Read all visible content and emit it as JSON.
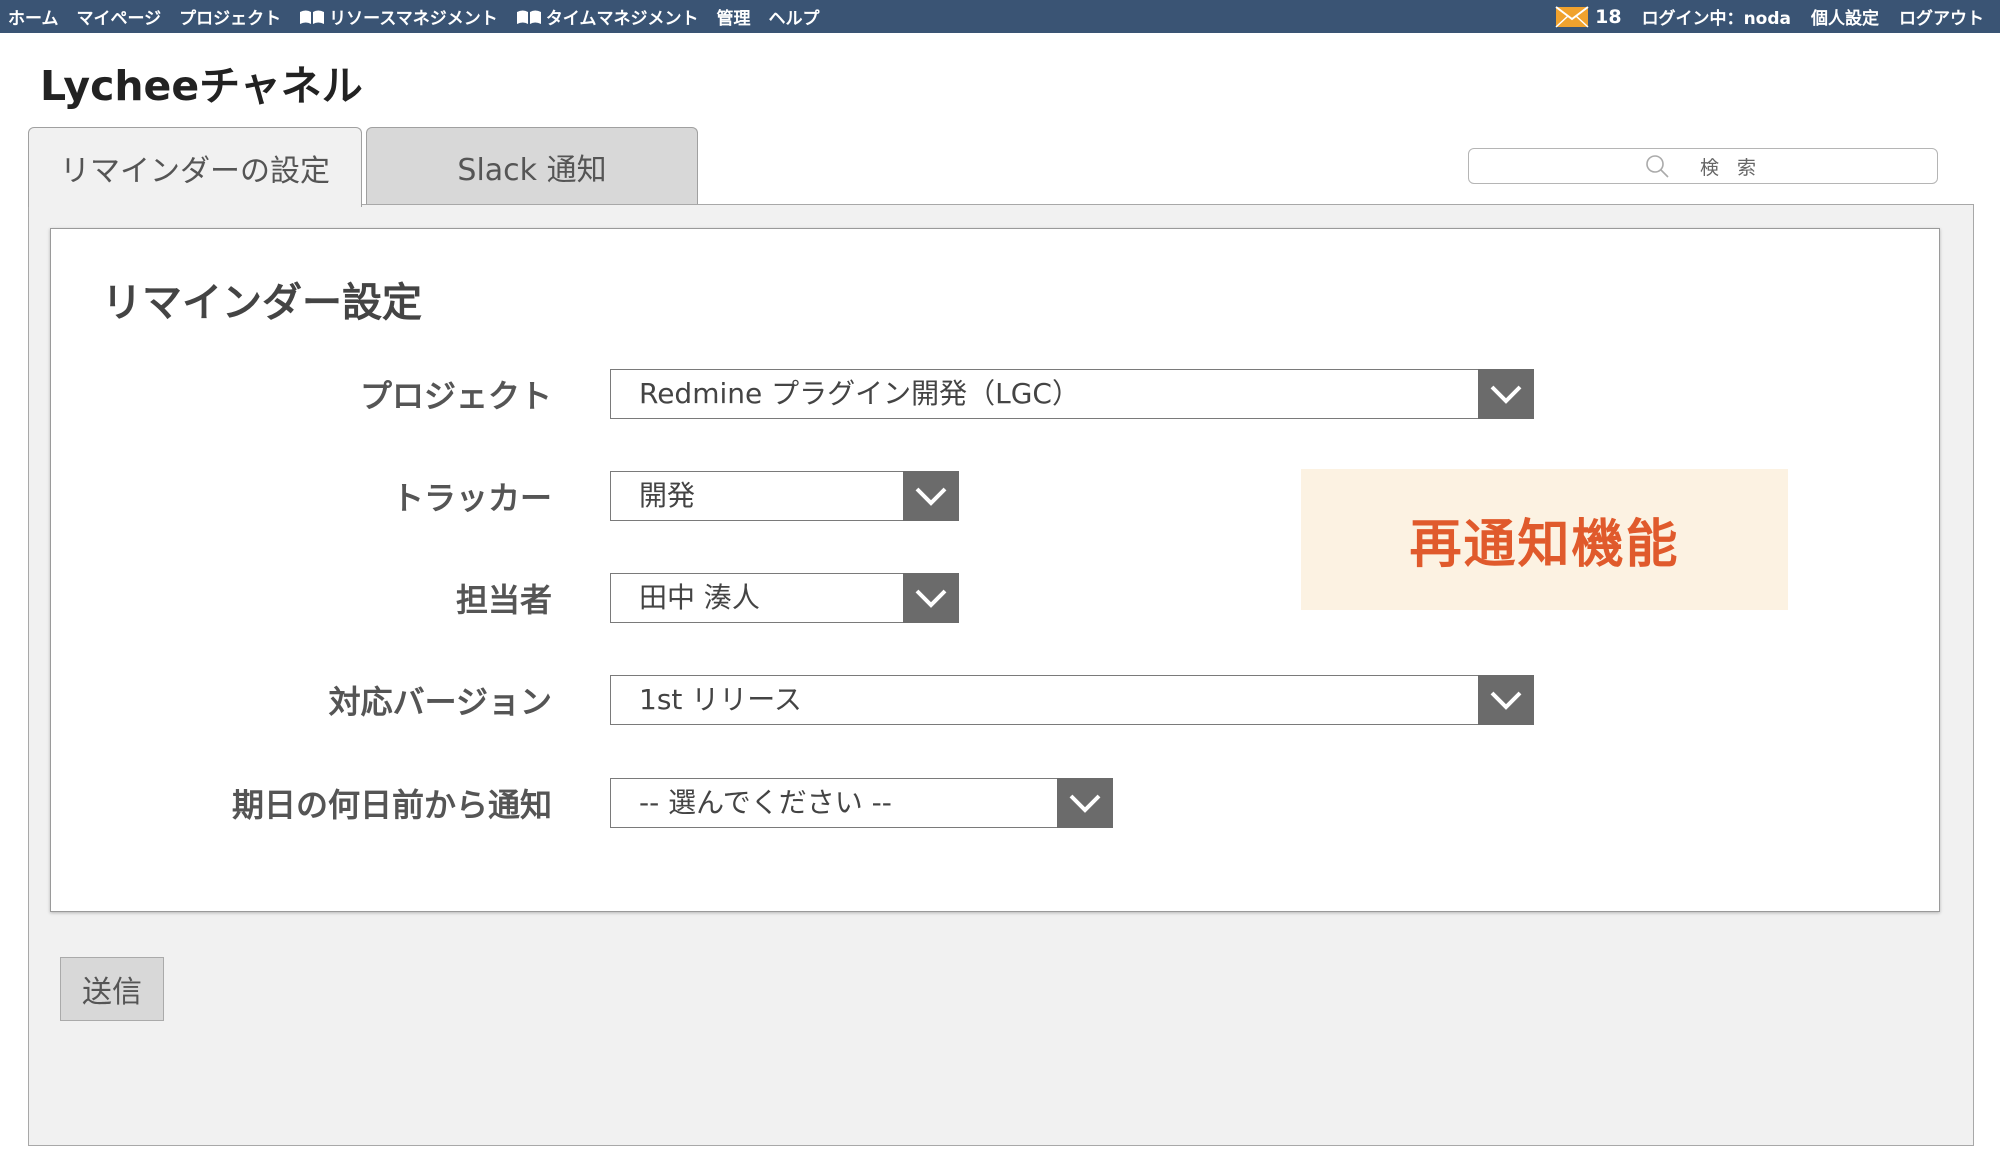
{
  "topbar": {
    "nav": [
      {
        "label": "ホーム",
        "icon": ""
      },
      {
        "label": "マイページ",
        "icon": ""
      },
      {
        "label": "プロジェクト",
        "icon": ""
      },
      {
        "label": "リソースマネジメント",
        "icon": "book-icon"
      },
      {
        "label": "タイムマネジメント",
        "icon": "book-icon"
      },
      {
        "label": "管理",
        "icon": ""
      },
      {
        "label": "ヘルプ",
        "icon": ""
      }
    ],
    "mail_count": "18",
    "login_label": "ログイン中：",
    "login_user": "noda",
    "personal_settings": "個人設定",
    "logout": "ログアウト",
    "bar_color": "#3a5474"
  },
  "app_title": "Lycheeチャネル",
  "tabs": {
    "reminder": "リマインダーの設定",
    "slack": "Slack 通知"
  },
  "search": {
    "placeholder": "検 索"
  },
  "form": {
    "title": "リマインダー設定",
    "fields": [
      {
        "label": "プロジェクト",
        "value": "Redmine プラグイン開発（LGC）"
      },
      {
        "label": "トラッカー",
        "value": "開発"
      },
      {
        "label": "担当者",
        "value": "田中 湊人"
      },
      {
        "label": "対応バージョン",
        "value": "1st リリース"
      },
      {
        "label": "期日の何日前から通知",
        "value": "-- 選んでください --"
      }
    ]
  },
  "feature_badge": {
    "text": "再通知機能",
    "color": "#e05a2c",
    "background": "#fcf2e2"
  },
  "submit_label": "送信"
}
